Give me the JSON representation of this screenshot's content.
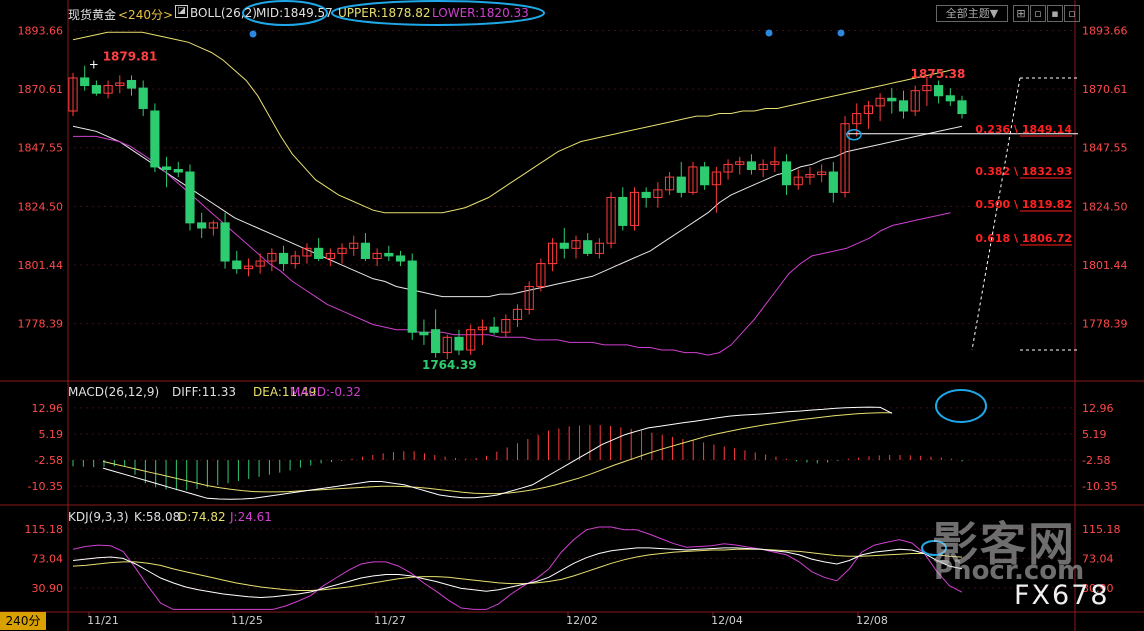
{
  "main": {
    "instrument": "现货黄金",
    "period_tag": "<240分>",
    "boll_label": "BOLL(26,2)",
    "mid_label": "MID:1849.57",
    "upper_label": "UPPER:1878.82",
    "lower_label": "LOWER:1820.33",
    "theme_button": "全部主题▼",
    "y_ticks": [
      "1893.66",
      "1870.61",
      "1847.55",
      "1824.50",
      "1801.44",
      "1778.39"
    ],
    "high_label": "1879.81",
    "low_label": "1764.39",
    "recent_high_label": "1875.38",
    "fib_levels": [
      {
        "label": "0.236 \\ 1849.14",
        "value": 1849.14
      },
      {
        "label": "0.382 \\ 1832.93",
        "value": 1832.93
      },
      {
        "label": "0.500 \\ 1819.82",
        "value": 1819.82
      },
      {
        "label": "0.618 \\ 1806.72",
        "value": 1806.72
      }
    ]
  },
  "macd": {
    "title": "MACD(26,12,9)",
    "diff_label": "DIFF:11.33",
    "dea_label": "DEA:11.49",
    "macd_label": "MACD:-0.32",
    "y_ticks": [
      "12.96",
      "5.19",
      "-2.58",
      "-10.35"
    ]
  },
  "kdj": {
    "title": "KDJ(9,3,3)",
    "k_label": "K:58.08",
    "d_label": "D:74.82",
    "j_label": "J:24.61",
    "y_ticks": [
      "115.18",
      "73.04",
      "30.90"
    ]
  },
  "x_axis": {
    "period_button": "240分",
    "date_labels": [
      "11/21",
      "11/25",
      "11/27",
      "12/02",
      "12/04",
      "12/08"
    ]
  },
  "watermark": {
    "text1": "影客网",
    "text2": "Phocr.com",
    "text3": "FX678"
  },
  "colors": {
    "up": "#ff3c3c",
    "down": "#2ecc71",
    "mid": "#e8e8e8",
    "upper": "#e8e070",
    "lower": "#d040d0",
    "axis": "#ff4a4a",
    "annot": "#1fa8e8",
    "fib": "#ff2020",
    "diff": "#ffffff",
    "dea": "#e8e070",
    "macd_bar_pos": "#ff3c3c",
    "macd_bar_neg": "#2ecc71"
  },
  "chart_data": [
    {
      "type": "candlestick",
      "title": "现货黄金 240分 BOLL(26,2)",
      "ylim": [
        1757,
        1897
      ],
      "candles": [
        {
          "o": 1862,
          "h": 1877,
          "l": 1860,
          "c": 1875
        },
        {
          "o": 1875,
          "h": 1879.81,
          "l": 1870,
          "c": 1872
        },
        {
          "o": 1872,
          "h": 1874,
          "l": 1868,
          "c": 1869
        },
        {
          "o": 1869,
          "h": 1874,
          "l": 1867,
          "c": 1872
        },
        {
          "o": 1872,
          "h": 1876,
          "l": 1869,
          "c": 1873
        },
        {
          "o": 1874,
          "h": 1876,
          "l": 1868,
          "c": 1871
        },
        {
          "o": 1871,
          "h": 1874,
          "l": 1860,
          "c": 1863
        },
        {
          "o": 1862,
          "h": 1865,
          "l": 1838,
          "c": 1840
        },
        {
          "o": 1840,
          "h": 1844,
          "l": 1832,
          "c": 1839
        },
        {
          "o": 1839,
          "h": 1842,
          "l": 1836,
          "c": 1838
        },
        {
          "o": 1838,
          "h": 1841,
          "l": 1815,
          "c": 1818
        },
        {
          "o": 1818,
          "h": 1822,
          "l": 1812,
          "c": 1816
        },
        {
          "o": 1816,
          "h": 1819,
          "l": 1813,
          "c": 1818
        },
        {
          "o": 1818,
          "h": 1822,
          "l": 1800,
          "c": 1803
        },
        {
          "o": 1803,
          "h": 1807,
          "l": 1798,
          "c": 1800
        },
        {
          "o": 1800,
          "h": 1804,
          "l": 1797,
          "c": 1801
        },
        {
          "o": 1801,
          "h": 1806,
          "l": 1798,
          "c": 1803
        },
        {
          "o": 1803,
          "h": 1808,
          "l": 1799,
          "c": 1806
        },
        {
          "o": 1806,
          "h": 1809,
          "l": 1799,
          "c": 1802
        },
        {
          "o": 1802,
          "h": 1807,
          "l": 1800,
          "c": 1805
        },
        {
          "o": 1805,
          "h": 1810,
          "l": 1802,
          "c": 1808
        },
        {
          "o": 1808,
          "h": 1812,
          "l": 1803,
          "c": 1804
        },
        {
          "o": 1804,
          "h": 1808,
          "l": 1801,
          "c": 1806
        },
        {
          "o": 1806,
          "h": 1810,
          "l": 1802,
          "c": 1808
        },
        {
          "o": 1808,
          "h": 1813,
          "l": 1805,
          "c": 1810
        },
        {
          "o": 1810,
          "h": 1814,
          "l": 1803,
          "c": 1804
        },
        {
          "o": 1804,
          "h": 1808,
          "l": 1801,
          "c": 1806
        },
        {
          "o": 1806,
          "h": 1809,
          "l": 1803,
          "c": 1805
        },
        {
          "o": 1805,
          "h": 1807,
          "l": 1801,
          "c": 1803
        },
        {
          "o": 1803,
          "h": 1806,
          "l": 1772,
          "c": 1775
        },
        {
          "o": 1775,
          "h": 1780,
          "l": 1770,
          "c": 1774
        },
        {
          "o": 1776,
          "h": 1784,
          "l": 1765,
          "c": 1767
        },
        {
          "o": 1767,
          "h": 1774,
          "l": 1764.39,
          "c": 1773
        },
        {
          "o": 1773,
          "h": 1776,
          "l": 1766,
          "c": 1768
        },
        {
          "o": 1768,
          "h": 1778,
          "l": 1766,
          "c": 1776
        },
        {
          "o": 1776,
          "h": 1780,
          "l": 1770,
          "c": 1777
        },
        {
          "o": 1777,
          "h": 1781,
          "l": 1774,
          "c": 1775
        },
        {
          "o": 1775,
          "h": 1782,
          "l": 1773,
          "c": 1780
        },
        {
          "o": 1780,
          "h": 1786,
          "l": 1777,
          "c": 1784
        },
        {
          "o": 1784,
          "h": 1795,
          "l": 1782,
          "c": 1793
        },
        {
          "o": 1793,
          "h": 1804,
          "l": 1791,
          "c": 1802
        },
        {
          "o": 1802,
          "h": 1812,
          "l": 1799,
          "c": 1810
        },
        {
          "o": 1810,
          "h": 1816,
          "l": 1804,
          "c": 1808
        },
        {
          "o": 1808,
          "h": 1813,
          "l": 1804,
          "c": 1811
        },
        {
          "o": 1811,
          "h": 1814,
          "l": 1805,
          "c": 1806
        },
        {
          "o": 1806,
          "h": 1812,
          "l": 1804,
          "c": 1810
        },
        {
          "o": 1810,
          "h": 1830,
          "l": 1808,
          "c": 1828
        },
        {
          "o": 1828,
          "h": 1832,
          "l": 1815,
          "c": 1817
        },
        {
          "o": 1817,
          "h": 1832,
          "l": 1815,
          "c": 1830
        },
        {
          "o": 1830,
          "h": 1832,
          "l": 1824,
          "c": 1828
        },
        {
          "o": 1828,
          "h": 1834,
          "l": 1824,
          "c": 1831
        },
        {
          "o": 1831,
          "h": 1838,
          "l": 1829,
          "c": 1836
        },
        {
          "o": 1836,
          "h": 1842,
          "l": 1828,
          "c": 1830
        },
        {
          "o": 1830,
          "h": 1842,
          "l": 1829,
          "c": 1840
        },
        {
          "o": 1840,
          "h": 1842,
          "l": 1831,
          "c": 1833
        },
        {
          "o": 1833,
          "h": 1840,
          "l": 1822,
          "c": 1838
        },
        {
          "o": 1838,
          "h": 1843,
          "l": 1835,
          "c": 1841
        },
        {
          "o": 1841,
          "h": 1844,
          "l": 1837,
          "c": 1842
        },
        {
          "o": 1842,
          "h": 1845,
          "l": 1837,
          "c": 1839
        },
        {
          "o": 1839,
          "h": 1843,
          "l": 1836,
          "c": 1841
        },
        {
          "o": 1841,
          "h": 1848,
          "l": 1838,
          "c": 1842
        },
        {
          "o": 1842,
          "h": 1845,
          "l": 1829,
          "c": 1833
        },
        {
          "o": 1833,
          "h": 1839,
          "l": 1831,
          "c": 1836
        },
        {
          "o": 1836,
          "h": 1840,
          "l": 1833,
          "c": 1837
        },
        {
          "o": 1837,
          "h": 1841,
          "l": 1834,
          "c": 1838
        },
        {
          "o": 1838,
          "h": 1842,
          "l": 1826,
          "c": 1830
        },
        {
          "o": 1830,
          "h": 1860,
          "l": 1828,
          "c": 1857
        },
        {
          "o": 1857,
          "h": 1865,
          "l": 1852,
          "c": 1861
        },
        {
          "o": 1861,
          "h": 1866,
          "l": 1855,
          "c": 1864
        },
        {
          "o": 1864,
          "h": 1869,
          "l": 1858,
          "c": 1867
        },
        {
          "o": 1867,
          "h": 1871,
          "l": 1861,
          "c": 1866
        },
        {
          "o": 1866,
          "h": 1870,
          "l": 1859,
          "c": 1862
        },
        {
          "o": 1862,
          "h": 1872,
          "l": 1860,
          "c": 1870
        },
        {
          "o": 1870,
          "h": 1875.38,
          "l": 1864,
          "c": 1872
        },
        {
          "o": 1872,
          "h": 1874,
          "l": 1865,
          "c": 1868
        },
        {
          "o": 1868,
          "h": 1871,
          "l": 1864,
          "c": 1866
        },
        {
          "o": 1866,
          "h": 1868,
          "l": 1859,
          "c": 1861
        }
      ],
      "mid": [
        1856,
        1855,
        1854,
        1852,
        1850,
        1847,
        1844,
        1841,
        1838,
        1835,
        1832,
        1829,
        1826,
        1823,
        1820,
        1818,
        1816,
        1814,
        1812,
        1810,
        1808,
        1806,
        1804,
        1802,
        1800,
        1798,
        1796,
        1795,
        1793,
        1792,
        1791,
        1790,
        1789,
        1789,
        1789,
        1789,
        1789,
        1790,
        1790,
        1791,
        1792,
        1793,
        1794,
        1795,
        1796,
        1797,
        1799,
        1801,
        1803,
        1805,
        1807,
        1810,
        1813,
        1816,
        1819,
        1822,
        1826,
        1829,
        1831,
        1833,
        1835,
        1837,
        1838,
        1840,
        1841,
        1843,
        1844,
        1846,
        1847,
        1848,
        1849,
        1850,
        1851,
        1852,
        1853,
        1854,
        1855,
        1856
      ],
      "upper": [
        1890,
        1891,
        1892,
        1893,
        1893,
        1893,
        1893,
        1892,
        1891,
        1890,
        1889,
        1887,
        1885,
        1882,
        1878,
        1874,
        1868,
        1860,
        1852,
        1845,
        1840,
        1835,
        1832,
        1829,
        1827,
        1825,
        1823,
        1822,
        1822,
        1822,
        1822,
        1822,
        1822,
        1823,
        1824,
        1826,
        1828,
        1831,
        1834,
        1837,
        1840,
        1843,
        1846,
        1848,
        1850,
        1851,
        1852,
        1853,
        1854,
        1855,
        1856,
        1857,
        1858,
        1859,
        1860,
        1860,
        1861,
        1861,
        1862,
        1862,
        1863,
        1863,
        1864,
        1865,
        1866,
        1867,
        1868,
        1869,
        1870,
        1871,
        1872,
        1873,
        1874,
        1875,
        1876,
        1877,
        1878
      ],
      "lower": [
        1852,
        1852,
        1852,
        1851,
        1850,
        1848,
        1845,
        1842,
        1838,
        1834,
        1830,
        1826,
        1822,
        1818,
        1814,
        1810,
        1806,
        1802,
        1799,
        1795,
        1792,
        1789,
        1786,
        1784,
        1782,
        1780,
        1778,
        1777,
        1776,
        1776,
        1775,
        1775,
        1775,
        1774,
        1774,
        1774,
        1774,
        1773,
        1773,
        1773,
        1772,
        1772,
        1772,
        1771,
        1771,
        1771,
        1770,
        1770,
        1770,
        1769,
        1769,
        1768,
        1768,
        1767,
        1767,
        1766,
        1767,
        1770,
        1775,
        1780,
        1786,
        1792,
        1798,
        1802,
        1805,
        1806,
        1807,
        1808,
        1810,
        1812,
        1815,
        1817,
        1818,
        1819,
        1820,
        1821,
        1822
      ],
      "fib_levels": [
        1849.14,
        1832.93,
        1819.82,
        1806.72
      ],
      "projection_box": {
        "top": 1875,
        "bottom": 1768
      }
    },
    {
      "type": "bar+line",
      "title": "MACD(26,12,9)",
      "ylim": [
        -14.5,
        16.5
      ],
      "macd": [
        -1.5,
        -1.6,
        -1.7,
        -1.6,
        -1.5,
        -1.6,
        -3.5,
        -5.5,
        -6.5,
        -7,
        -7.2,
        -7.2,
        -6.9,
        -6.5,
        -6,
        -5.5,
        -5,
        -4.5,
        -4,
        -3.5,
        -3,
        -2.5,
        -1.8,
        -1.3,
        -0.8,
        -0.5,
        -0.2,
        0.3,
        0.8,
        1.2,
        1.6,
        1.9,
        2.1,
        2.1,
        1.6,
        1.2,
        0.8,
        0.5,
        0.3,
        0.5,
        1,
        2,
        3,
        4,
        5,
        6,
        7,
        7.5,
        8,
        8.2,
        8.3,
        8.3,
        8.1,
        7.8,
        7.4,
        7,
        6.5,
        6,
        5.5,
        5,
        4.6,
        4.2,
        3.7,
        3.2,
        2.8,
        2.3,
        1.8,
        1.3,
        0.8,
        0.3,
        -0.3,
        -0.6,
        -0.8,
        -0.6,
        -0.2,
        0.3,
        0.6,
        0.9,
        1.1,
        1.2,
        1.2,
        1.1,
        1,
        0.8,
        0.6,
        0.3,
        -0.32
      ],
      "diff": [
        -5,
        -6,
        -7,
        -8,
        -9,
        -10,
        -11,
        -12,
        -13,
        -14,
        -14.2,
        -14.3,
        -14.2,
        -14,
        -13.5,
        -13,
        -12.5,
        -12,
        -11.5,
        -11,
        -10.5,
        -10,
        -9.5,
        -9,
        -9,
        -9.5,
        -10,
        -11,
        -12,
        -13,
        -13.5,
        -13.8,
        -13.8,
        -13.5,
        -13,
        -12,
        -11,
        -10,
        -8,
        -6,
        -4,
        -2,
        0,
        2,
        3.5,
        5,
        6,
        7,
        7.5,
        8,
        8.5,
        9,
        9.5,
        10,
        10.5,
        10.8,
        11,
        11.2,
        11.5,
        11.8,
        12,
        12.3,
        12.5,
        12.8,
        13,
        13.1,
        13.2,
        13.1,
        11.33
      ],
      "dea": [
        -3,
        -3.8,
        -4.6,
        -5.4,
        -6.2,
        -7,
        -7.8,
        -8.6,
        -9.4,
        -10.2,
        -10.8,
        -11.3,
        -11.7,
        -12,
        -12.1,
        -12.1,
        -12,
        -11.8,
        -11.6,
        -11.4,
        -11.2,
        -11,
        -10.8,
        -10.6,
        -10.4,
        -10.4,
        -10.5,
        -10.7,
        -11,
        -11.4,
        -11.8,
        -12.2,
        -12.5,
        -12.6,
        -12.6,
        -12.4,
        -12,
        -11.5,
        -10.8,
        -10,
        -9,
        -8,
        -6.8,
        -5.5,
        -4.2,
        -3,
        -1.8,
        -0.6,
        0.5,
        1.5,
        2.5,
        3.5,
        4.5,
        5.3,
        6,
        6.7,
        7.3,
        7.9,
        8.4,
        8.9,
        9.4,
        9.8,
        10.2,
        10.6,
        10.9,
        11.2,
        11.4,
        11.5,
        11.49
      ]
    },
    {
      "type": "line",
      "title": "KDJ(9,3,3)",
      "ylim": [
        2,
        128
      ],
      "k": [
        70,
        72,
        74,
        75,
        73,
        65,
        55,
        45,
        38,
        32,
        28,
        25,
        22,
        20,
        18,
        17,
        18,
        20,
        22,
        25,
        30,
        35,
        40,
        45,
        48,
        50,
        50,
        48,
        44,
        40,
        35,
        30,
        28,
        26,
        28,
        32,
        36,
        40,
        46,
        56,
        66,
        74,
        80,
        84,
        86,
        88,
        88,
        87,
        86,
        85,
        86,
        87,
        88,
        88,
        87,
        86,
        84,
        82,
        78,
        72,
        68,
        65,
        70,
        78,
        82,
        84,
        86,
        85,
        80,
        70,
        62,
        58.08
      ],
      "d": [
        62,
        63,
        65,
        67,
        68,
        68,
        66,
        63,
        58,
        54,
        50,
        46,
        42,
        38,
        35,
        32,
        30,
        28,
        27,
        27,
        28,
        30,
        32,
        35,
        38,
        41,
        44,
        46,
        47,
        47,
        46,
        44,
        42,
        40,
        38,
        37,
        37,
        38,
        40,
        43,
        48,
        54,
        60,
        66,
        71,
        75,
        78,
        80,
        82,
        83,
        84,
        85,
        85,
        86,
        86,
        86,
        85,
        84,
        83,
        81,
        79,
        77,
        76,
        76,
        77,
        78,
        79,
        80,
        80,
        78,
        76,
        74.82
      ],
      "j": [
        86,
        90,
        92,
        91,
        83,
        59,
        33,
        9,
        0,
        0,
        0,
        0,
        0,
        0,
        0,
        0,
        0,
        5,
        12,
        20,
        34,
        45,
        56,
        65,
        68,
        68,
        62,
        52,
        38,
        26,
        13,
        2,
        0,
        0,
        8,
        22,
        34,
        44,
        58,
        82,
        100,
        114,
        118,
        118,
        114,
        114,
        108,
        101,
        94,
        89,
        90,
        91,
        94,
        92,
        89,
        86,
        82,
        78,
        68,
        54,
        46,
        41,
        58,
        82,
        92,
        96,
        100,
        95,
        80,
        54,
        34,
        24.61
      ]
    }
  ]
}
